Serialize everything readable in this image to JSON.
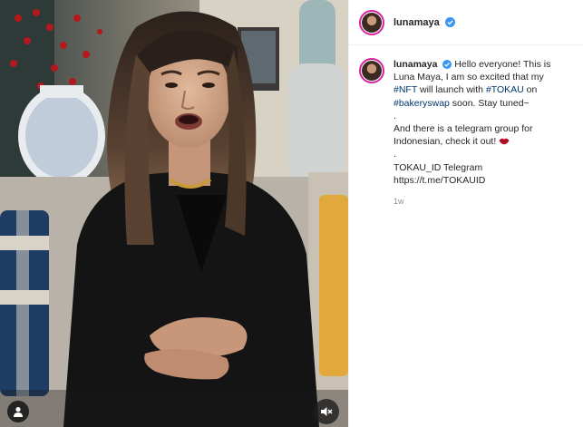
{
  "post": {
    "author": "lunamaya",
    "verified": true,
    "caption": {
      "username": "lunamaya",
      "line1_prefix": "Hello everyone! This is Luna Maya, I am so excited that my ",
      "tag_nft": "#NFT",
      "line1_mid": " will launch with ",
      "tag_tokau": "#TOKAU",
      "line1_mid2": " on ",
      "tag_bakeryswap": "#bakeryswap",
      "line1_suffix": " soon. Stay tuned~",
      "dot1": ".",
      "line2": "And there is a telegram group for Indonesian, check it out!",
      "dot2": ".",
      "telegram_label": "TOKAU_ID Telegram",
      "telegram_url": "https://t.me/TOKAUID"
    },
    "timestamp": "1w"
  },
  "icons": {
    "verified": "verified-badge-icon",
    "user_tag": "user-tag-icon",
    "mute": "speaker-muted-icon",
    "lips": "kiss-lips-emoji"
  },
  "colors": {
    "verified_blue": "#3897f0",
    "hashtag": "#00376b",
    "story_ring": "#d6249f",
    "timestamp": "#8e8e8e"
  }
}
